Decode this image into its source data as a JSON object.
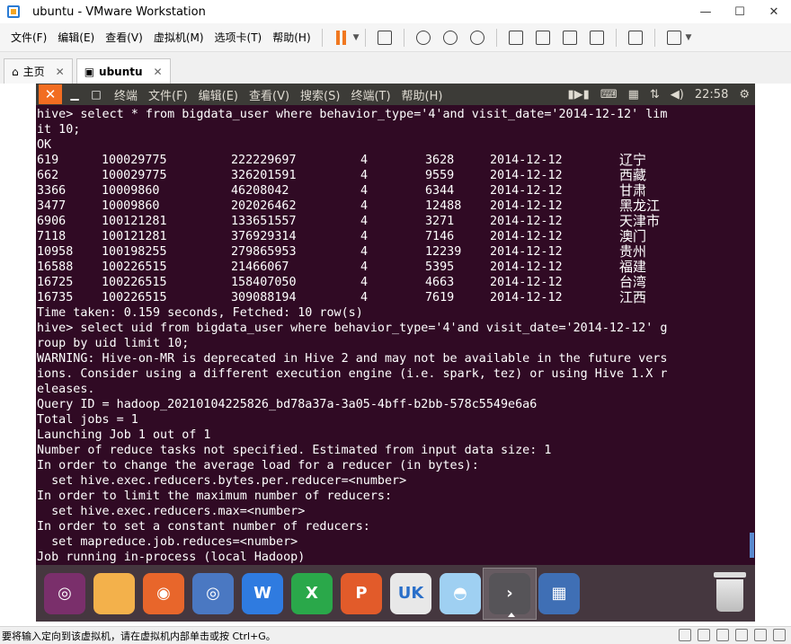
{
  "window": {
    "title": "ubuntu - VMware Workstation",
    "minimize": "—",
    "maximize": "☐",
    "close": "✕"
  },
  "menubar": {
    "items": [
      "文件(F)",
      "编辑(E)",
      "查看(V)",
      "虚拟机(M)",
      "选项卡(T)",
      "帮助(H)"
    ]
  },
  "tabs": [
    {
      "label": "主页",
      "icon": "home-icon",
      "close": "✕"
    },
    {
      "label": "ubuntu",
      "icon": "vm-icon",
      "close": "✕"
    }
  ],
  "ubuntu_topbar": {
    "close": "✕",
    "minimize": "▁",
    "maximize": "□",
    "menus": [
      "终端",
      "文件(F)",
      "编辑(E)",
      "查看(V)",
      "搜索(S)",
      "终端(T)",
      "帮助(H)"
    ],
    "time": "22:58"
  },
  "terminal": {
    "lines_before": [
      "hive> select * from bigdata_user where behavior_type='4'and visit_date='2014-12-12' lim",
      "it 10;",
      "OK"
    ],
    "rows": [
      [
        "619",
        "100029775",
        "222229697",
        "4",
        "3628",
        "2014-12-12",
        "辽宁"
      ],
      [
        "662",
        "100029775",
        "326201591",
        "4",
        "9559",
        "2014-12-12",
        "西藏"
      ],
      [
        "3366",
        "10009860",
        "46208042",
        "4",
        "6344",
        "2014-12-12",
        "甘肃"
      ],
      [
        "3477",
        "10009860",
        "202026462",
        "4",
        "12488",
        "2014-12-12",
        "黑龙江"
      ],
      [
        "6906",
        "100121281",
        "133651557",
        "4",
        "3271",
        "2014-12-12",
        "天津市"
      ],
      [
        "7118",
        "100121281",
        "376929314",
        "4",
        "7146",
        "2014-12-12",
        "澳门"
      ],
      [
        "10958",
        "100198255",
        "279865953",
        "4",
        "12239",
        "2014-12-12",
        "贵州"
      ],
      [
        "16588",
        "100226515",
        "21466067",
        "4",
        "5395",
        "2014-12-12",
        "福建"
      ],
      [
        "16725",
        "100226515",
        "158407050",
        "4",
        "4663",
        "2014-12-12",
        "台湾"
      ],
      [
        "16735",
        "100226515",
        "309088194",
        "4",
        "7619",
        "2014-12-12",
        "江西"
      ]
    ],
    "lines_after": [
      "Time taken: 0.159 seconds, Fetched: 10 row(s)",
      "hive> select uid from bigdata_user where behavior_type='4'and visit_date='2014-12-12' g",
      "roup by uid limit 10;",
      "WARNING: Hive-on-MR is deprecated in Hive 2 and may not be available in the future vers",
      "ions. Consider using a different execution engine (i.e. spark, tez) or using Hive 1.X r",
      "eleases.",
      "Query ID = hadoop_20210104225826_bd78a37a-3a05-4bff-b2bb-578c5549e6a6",
      "Total jobs = 1",
      "Launching Job 1 out of 1",
      "Number of reduce tasks not specified. Estimated from input data size: 1",
      "In order to change the average load for a reducer (in bytes):",
      "  set hive.exec.reducers.bytes.per.reducer=<number>",
      "In order to limit the maximum number of reducers:",
      "  set hive.exec.reducers.max=<number>",
      "In order to set a constant number of reducers:",
      "  set mapreduce.job.reduces=<number>",
      "Job running in-process (local Hadoop)"
    ]
  },
  "dock": {
    "items": [
      {
        "name": "ubuntu-dash-icon",
        "color": "#7a2f6b",
        "glyph": "◎"
      },
      {
        "name": "files-icon",
        "color": "#f3b14b",
        "glyph": ""
      },
      {
        "name": "firefox-icon",
        "color": "#e8662b",
        "glyph": "◉"
      },
      {
        "name": "chromium-icon",
        "color": "#4a78c2",
        "glyph": "◎"
      },
      {
        "name": "wps-writer-icon",
        "color": "#2f7be0",
        "glyph": "W"
      },
      {
        "name": "wps-spreadsheet-icon",
        "color": "#2aa84a",
        "glyph": "X"
      },
      {
        "name": "wps-presentation-icon",
        "color": "#e25b2a",
        "glyph": "P"
      },
      {
        "name": "ubuntu-kylin-store-icon",
        "color": "#e8e8e8",
        "glyph": "UK"
      },
      {
        "name": "robot-app-icon",
        "color": "#9fd0f2",
        "glyph": "◓"
      },
      {
        "name": "terminal-icon",
        "color": "#565458",
        "glyph": "›"
      },
      {
        "name": "workspace-switcher-icon",
        "color": "#3f6fb5",
        "glyph": "▦"
      }
    ]
  },
  "statusbar": {
    "text": "要将输入定向到该虚拟机，请在虚拟机内部单击或按 Ctrl+G。"
  }
}
